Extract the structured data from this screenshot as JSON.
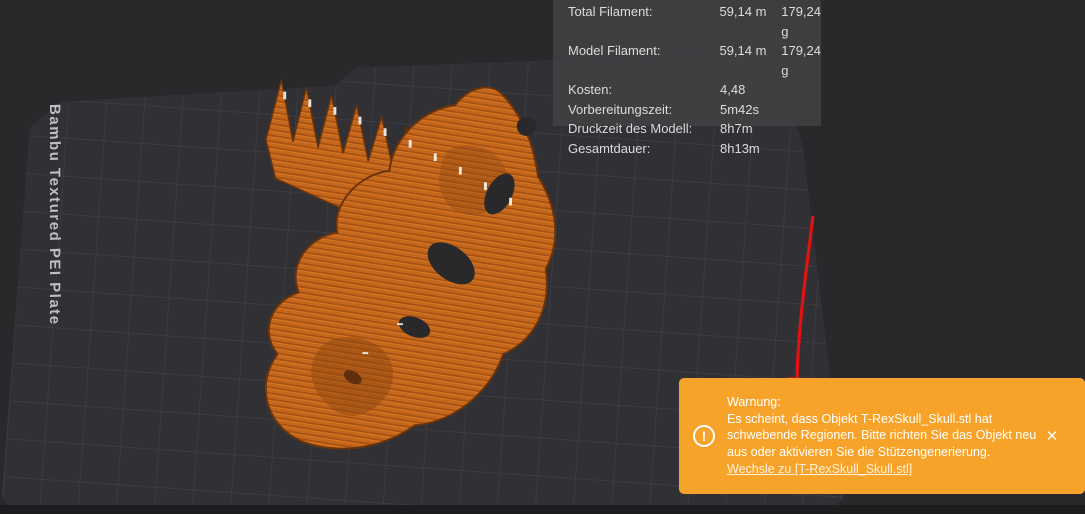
{
  "viewport": {
    "plate_label": "Bambu Textured PEI Plate",
    "model_name": "T-RexSkull_Skull.stl"
  },
  "stats_panel": {
    "rows": [
      {
        "label": "Total Filament:",
        "value": "59,14 m",
        "value2": "179,24 g"
      },
      {
        "label": "Model Filament:",
        "value": "59,14 m",
        "value2": "179,24 g"
      },
      {
        "label": "Kosten:",
        "value": "4,48",
        "value2": ""
      },
      {
        "label": "Vorbereitungszeit:",
        "value": "5m42s",
        "value2": ""
      },
      {
        "label": "Druckzeit des Modell:",
        "value": "8h7m",
        "value2": ""
      },
      {
        "label": "Gesamtdauer:",
        "value": "8h13m",
        "value2": ""
      }
    ]
  },
  "warning_toast": {
    "title": "Warnung:",
    "message": "Es scheint, dass Objekt T-RexSkull_Skull.stl hat schwebende Regionen. Bitte richten Sie das Objekt neu aus oder aktivieren Sie die Stützengenerierung.",
    "link": "Wechsle zu [T-RexSkull_Skull.stl]",
    "icon_glyph": "!",
    "close_label": "✕"
  },
  "colors": {
    "toast_bg": "#f7a32a",
    "arrow_red": "#e01212",
    "model_orange": "#c4661c",
    "viewport_bg": "#29292c",
    "plate_bg": "#313135"
  }
}
